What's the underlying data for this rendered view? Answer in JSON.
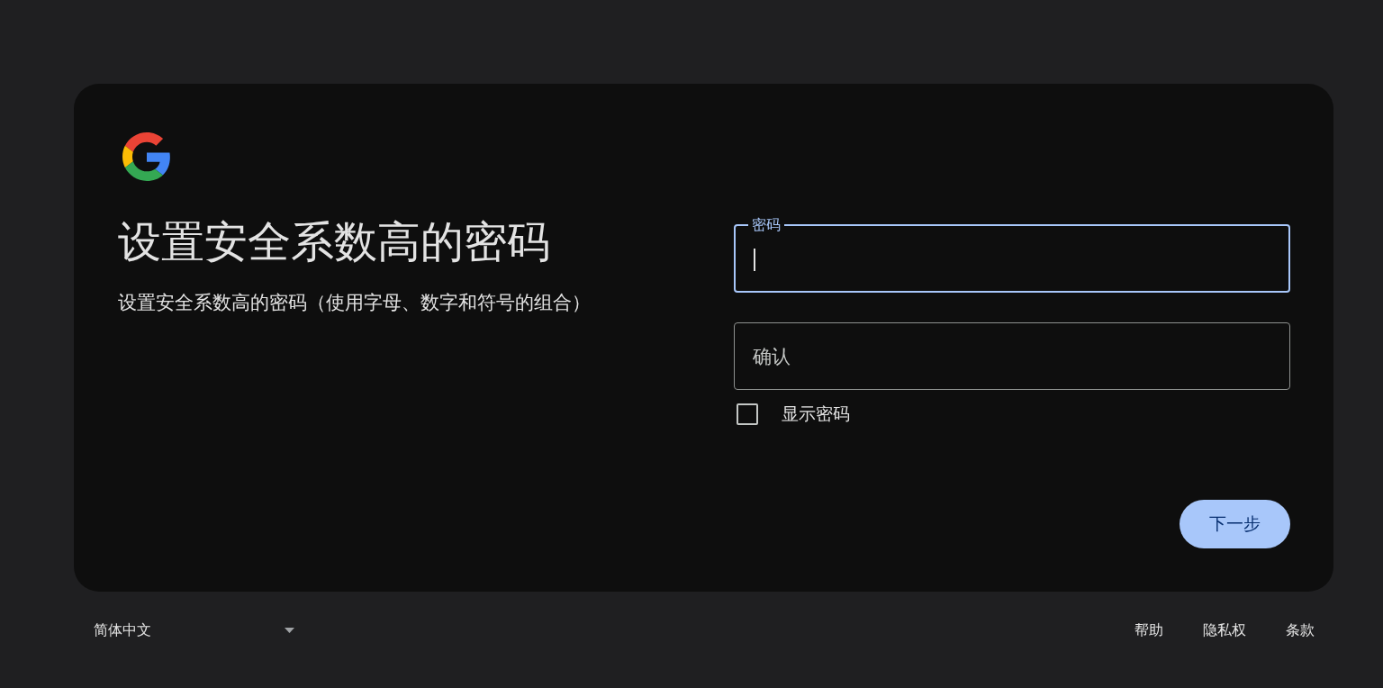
{
  "heading": {
    "title": "设置安全系数高的密码",
    "subtitle": "设置安全系数高的密码（使用字母、数字和符号的组合）"
  },
  "fields": [
    {
      "label": "密码",
      "focused": true
    },
    {
      "label": "确认",
      "focused": false
    }
  ],
  "show_password": {
    "label": "显示密码",
    "checked": false
  },
  "next_button": {
    "label": "下一步"
  },
  "footer": {
    "language": "简体中文",
    "links": [
      "帮助",
      "隐私权",
      "条款"
    ]
  }
}
